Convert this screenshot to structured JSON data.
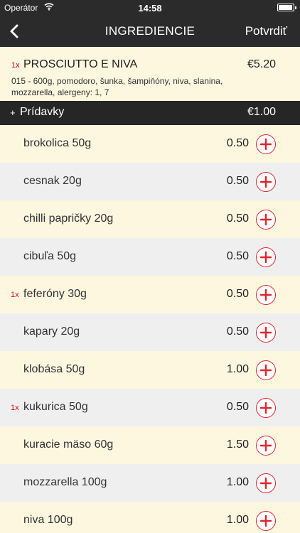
{
  "status_bar": {
    "carrier": "Operátor",
    "time": "14:58"
  },
  "nav": {
    "title": "INGREDIENCIE",
    "confirm_label": "Potvrdiť"
  },
  "product": {
    "quantity": "1x",
    "name": "PROSCIUTTO E NIVA",
    "price": "€5.20",
    "description": "015 - 600g, pomodoro, šunka, šampiňóny, niva, slanina, mozzarella, alergeny: 1, 7"
  },
  "addons_header": {
    "plus": "+",
    "label": "Prídavky",
    "price": "€1.00"
  },
  "ingredients": [
    {
      "quantity": "",
      "name": "brokolica 50g",
      "price": "0.50"
    },
    {
      "quantity": "",
      "name": "cesnak 20g",
      "price": "0.50"
    },
    {
      "quantity": "",
      "name": "chilli papričky 20g",
      "price": "0.50"
    },
    {
      "quantity": "",
      "name": "cibuľa 50g",
      "price": "0.50"
    },
    {
      "quantity": "1x",
      "name": "feferóny 30g",
      "price": "0.50"
    },
    {
      "quantity": "",
      "name": "kapary 20g",
      "price": "0.50"
    },
    {
      "quantity": "",
      "name": "klobása 50g",
      "price": "1.00"
    },
    {
      "quantity": "1x",
      "name": "kukurica 50g",
      "price": "0.50"
    },
    {
      "quantity": "",
      "name": "kuracie mäso 60g",
      "price": "1.50"
    },
    {
      "quantity": "",
      "name": "mozzarella 100g",
      "price": "1.00"
    },
    {
      "quantity": "",
      "name": "niva 100g",
      "price": "1.00"
    }
  ],
  "colors": {
    "bar": "#2b2b2b",
    "accent_red": "#e0242b",
    "row_cream": "#fdf7e0",
    "row_gray": "#efefef"
  }
}
